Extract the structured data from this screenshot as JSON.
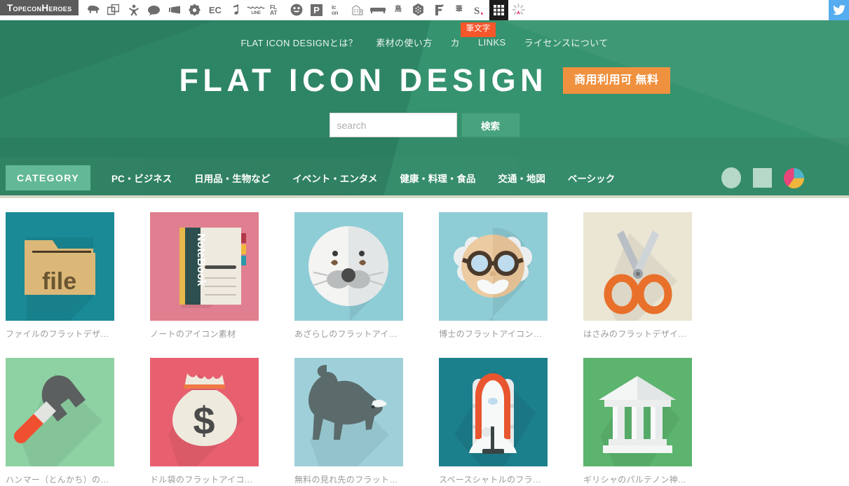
{
  "topbar": {
    "brand": "TopeconHeroes",
    "icons": [
      {
        "name": "sheep-icon",
        "glyph": "⏺"
      },
      {
        "name": "copy-windows-icon",
        "glyph": "⧉"
      },
      {
        "name": "person-cheering-icon",
        "glyph": "⯅"
      },
      {
        "name": "speech-bubble-icon",
        "glyph": "●"
      },
      {
        "name": "megaphone-icon",
        "glyph": "▰"
      },
      {
        "name": "flower-gear-icon",
        "glyph": "❁"
      },
      {
        "name": "ec-text-icon",
        "glyph": "EC"
      },
      {
        "name": "music-note-icon",
        "glyph": "♪"
      },
      {
        "name": "line-wave-icon",
        "glyph": "LINE"
      },
      {
        "name": "flat-text-icon",
        "glyph": "FL\nAT"
      },
      {
        "name": "smiley-face-icon",
        "glyph": "☺"
      },
      {
        "name": "parking-p-icon",
        "glyph": "P"
      },
      {
        "name": "icon-text-icon",
        "glyph": "ic\non"
      },
      {
        "name": "building-icon",
        "glyph": "⌂"
      },
      {
        "name": "sofa-icon",
        "glyph": "▬"
      },
      {
        "name": "bird-kanji-icon",
        "glyph": "鳥"
      },
      {
        "name": "hexagon-pattern-icon",
        "glyph": "⬢"
      },
      {
        "name": "f-mark-icon",
        "glyph": "F"
      },
      {
        "name": "brush-kanji-icon",
        "glyph": "筆"
      },
      {
        "name": "s-sparkle-icon",
        "glyph": "S"
      },
      {
        "name": "grid-icon",
        "glyph": "▒"
      },
      {
        "name": "sparkle-burst-icon",
        "glyph": "✳"
      }
    ],
    "twitter_label": "twitter-icon"
  },
  "hero": {
    "nav": [
      {
        "label": "FLAT ICON DESIGNとは？",
        "name": "nav-about"
      },
      {
        "label": "素材の使い方",
        "name": "nav-how-to-use"
      },
      {
        "label": "カ",
        "name": "nav-category-partial"
      },
      {
        "label": "LINKS",
        "name": "nav-links"
      },
      {
        "label": "ライセンスについて",
        "name": "nav-license"
      }
    ],
    "brush_badge": "筆文字",
    "title": "FLAT ICON DESIGN",
    "free_badge": "商用利用可 無料",
    "search_placeholder": "search",
    "search_value": "",
    "search_button": "検索"
  },
  "category": {
    "pill_label": "CATEGORY",
    "items": [
      {
        "label": "PC・ビジネス",
        "name": "category-pc-business"
      },
      {
        "label": "日用品・生物など",
        "name": "category-daily-creatures"
      },
      {
        "label": "イベント・エンタメ",
        "name": "category-event-entertainment"
      },
      {
        "label": "健康・料理・食品",
        "name": "category-health-cooking-food"
      },
      {
        "label": "交通・地図",
        "name": "category-transport-map"
      },
      {
        "label": "ベーシック",
        "name": "category-basic"
      }
    ],
    "shape_filters": [
      {
        "name": "filter-circle-icon"
      },
      {
        "name": "filter-square-icon"
      },
      {
        "name": "filter-color-pie-icon"
      }
    ]
  },
  "colors": {
    "hero_green": "#36936f",
    "hero_green_dark": "#2e8565",
    "accent_orange": "#f0913f",
    "badge_red": "#f5562a",
    "category_pill": "#63b896",
    "search_button": "#47a37e",
    "twitter_blue": "#55acee",
    "brand_gray": "#5b5b5b"
  },
  "grid": {
    "items": [
      {
        "name": "icon-card-file",
        "caption": "ファイルのフラットデザ…",
        "bg": "#1a8a96",
        "art": "file-folder"
      },
      {
        "name": "icon-card-notebook",
        "caption": "ノートのアイコン素材",
        "bg": "#e07f8f",
        "art": "notebook"
      },
      {
        "name": "icon-card-seal",
        "caption": "あざらしのフラットアイ…",
        "bg": "#8fcdd6",
        "art": "seal"
      },
      {
        "name": "icon-card-doctor",
        "caption": "博士のフラットアイコン…",
        "bg": "#8fcdd6",
        "art": "doctor"
      },
      {
        "name": "icon-card-scissors",
        "caption": "はさみのフラットデザイ…",
        "bg": "#ebe5d4",
        "art": "scissors"
      },
      {
        "name": "icon-card-hammer",
        "caption": "ハンマー（とんかち）の…",
        "bg": "#8ed1a3",
        "art": "hammer"
      },
      {
        "name": "icon-card-money-bag",
        "caption": "ドル袋のフラットアイコ…",
        "bg": "#e8606f",
        "art": "money-bag"
      },
      {
        "name": "icon-card-bull",
        "caption": "無料の見れ先のフラット…",
        "bg": "#9fd0d9",
        "art": "bull"
      },
      {
        "name": "icon-card-space-shuttle",
        "caption": "スペースシャトルのフラ…",
        "bg": "#1c7f8c",
        "art": "shuttle"
      },
      {
        "name": "icon-card-parthenon",
        "caption": "ギリシャのパルテノン神…",
        "bg": "#5cb46e",
        "art": "parthenon"
      }
    ]
  }
}
